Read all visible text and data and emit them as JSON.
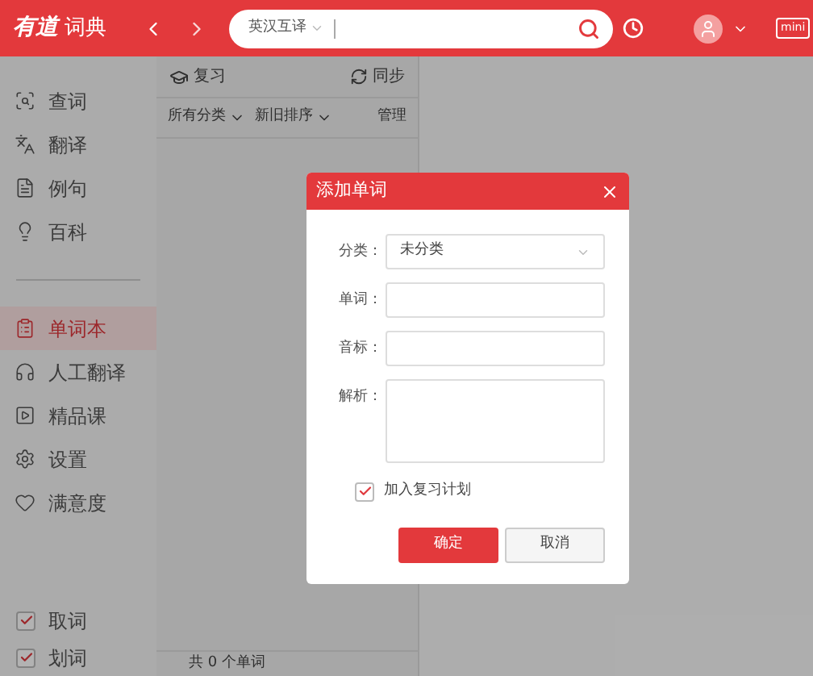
{
  "app": {
    "logo_brand": "有道",
    "logo_title": "词典",
    "search": {
      "mode": "英汉互译"
    },
    "mini_button": "mini"
  },
  "sidebar": {
    "items": [
      {
        "label": "查词",
        "selected": false
      },
      {
        "label": "翻译",
        "selected": false
      },
      {
        "label": "例句",
        "selected": false
      },
      {
        "label": "百科",
        "selected": false
      }
    ],
    "items_2": [
      {
        "label": "单词本",
        "selected": true
      },
      {
        "label": "人工翻译",
        "selected": false
      },
      {
        "label": "精品课",
        "selected": false
      },
      {
        "label": "设置",
        "selected": false
      },
      {
        "label": "满意度",
        "selected": false
      }
    ],
    "toggles": [
      {
        "label": "取词",
        "checked": true
      },
      {
        "label": "划词",
        "checked": true
      }
    ]
  },
  "wordbook": {
    "review": "复习",
    "sync": "同步",
    "filters": [
      "所有分类",
      "新旧排序"
    ],
    "manage": "管理",
    "footer": "共 0 个单词"
  },
  "dialog": {
    "title": "添加单词",
    "fields": [
      {
        "label": "分类：",
        "kind": "select",
        "value": "未分类"
      },
      {
        "label": "单词：",
        "kind": "text"
      },
      {
        "label": "音标：",
        "kind": "text"
      },
      {
        "label": "解析：",
        "kind": "textarea"
      }
    ],
    "review_plan": {
      "label": "加入复习计划",
      "checked": true
    },
    "buttons": [
      "确定",
      "取消"
    ]
  }
}
